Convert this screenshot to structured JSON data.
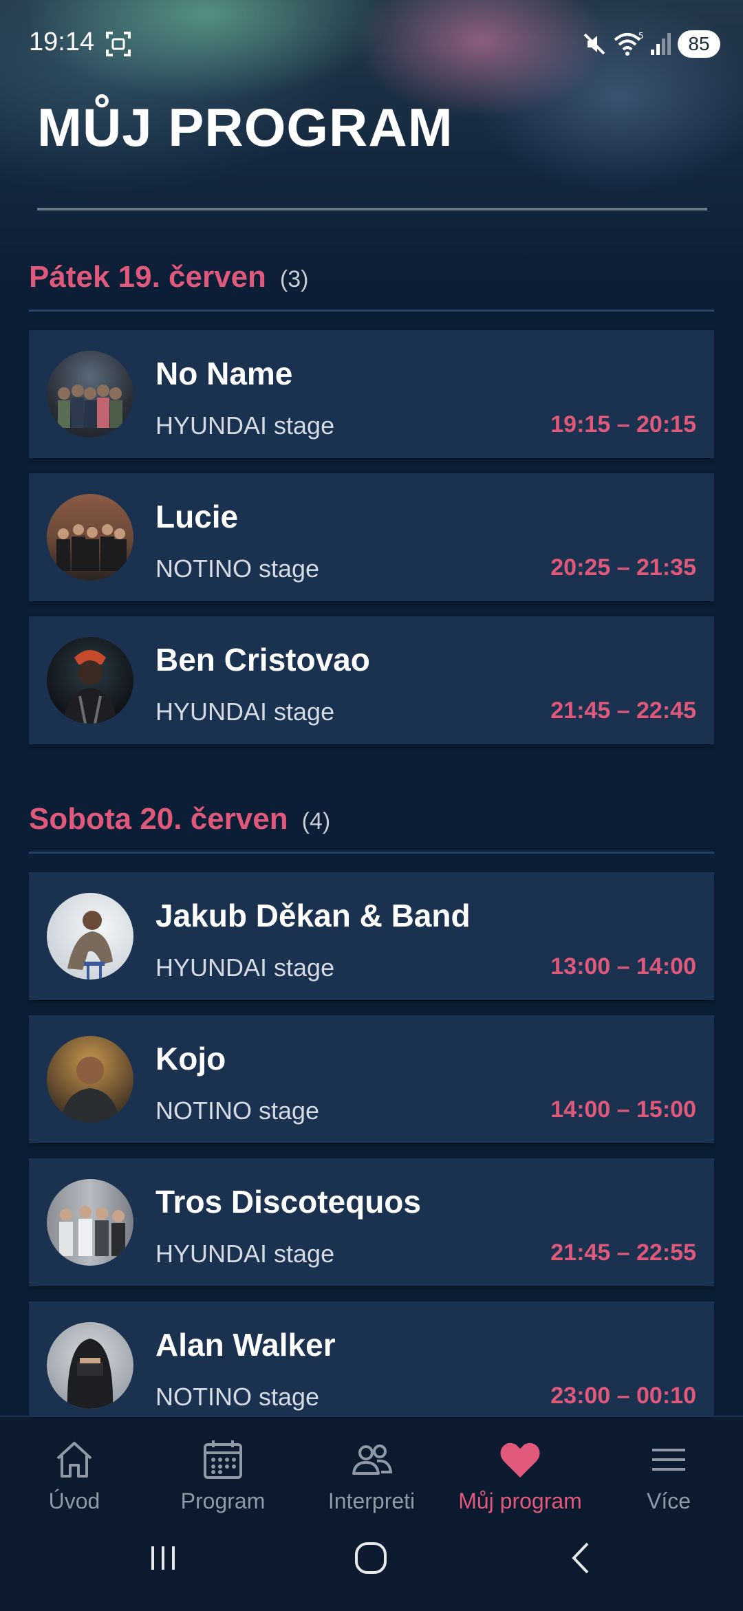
{
  "status_bar": {
    "time": "19:14",
    "battery": "85",
    "icons": [
      "screenshot-icon",
      "mute-icon",
      "wifi-icon",
      "signal-icon"
    ]
  },
  "page": {
    "title": "MŮJ PROGRAM"
  },
  "colors": {
    "accent": "#e0587a",
    "card": "#1a3250",
    "background": "#0c1e36"
  },
  "sections": [
    {
      "title": "Pátek 19. červen",
      "count": "(3)",
      "items": [
        {
          "name": "No Name",
          "stage": "HYUNDAI stage",
          "time": "19:15 – 20:15"
        },
        {
          "name": "Lucie",
          "stage": "NOTINO stage",
          "time": "20:25 – 21:35"
        },
        {
          "name": "Ben Cristovao",
          "stage": "HYUNDAI stage",
          "time": "21:45 – 22:45"
        }
      ]
    },
    {
      "title": "Sobota 20. červen",
      "count": "(4)",
      "items": [
        {
          "name": "Jakub Děkan & Band",
          "stage": "HYUNDAI stage",
          "time": "13:00 – 14:00"
        },
        {
          "name": "Kojo",
          "stage": "NOTINO stage",
          "time": "14:00 – 15:00"
        },
        {
          "name": "Tros Discotequos",
          "stage": "HYUNDAI stage",
          "time": "21:45 – 22:55"
        },
        {
          "name": "Alan Walker",
          "stage": "NOTINO stage",
          "time": "23:00 – 00:10"
        }
      ]
    }
  ],
  "bottom_nav": [
    {
      "label": "Úvod",
      "icon": "home-icon"
    },
    {
      "label": "Program",
      "icon": "calendar-icon"
    },
    {
      "label": "Interpreti",
      "icon": "people-icon"
    },
    {
      "label": "Můj program",
      "icon": "heart-icon",
      "active": true
    },
    {
      "label": "Více",
      "icon": "menu-icon"
    }
  ]
}
